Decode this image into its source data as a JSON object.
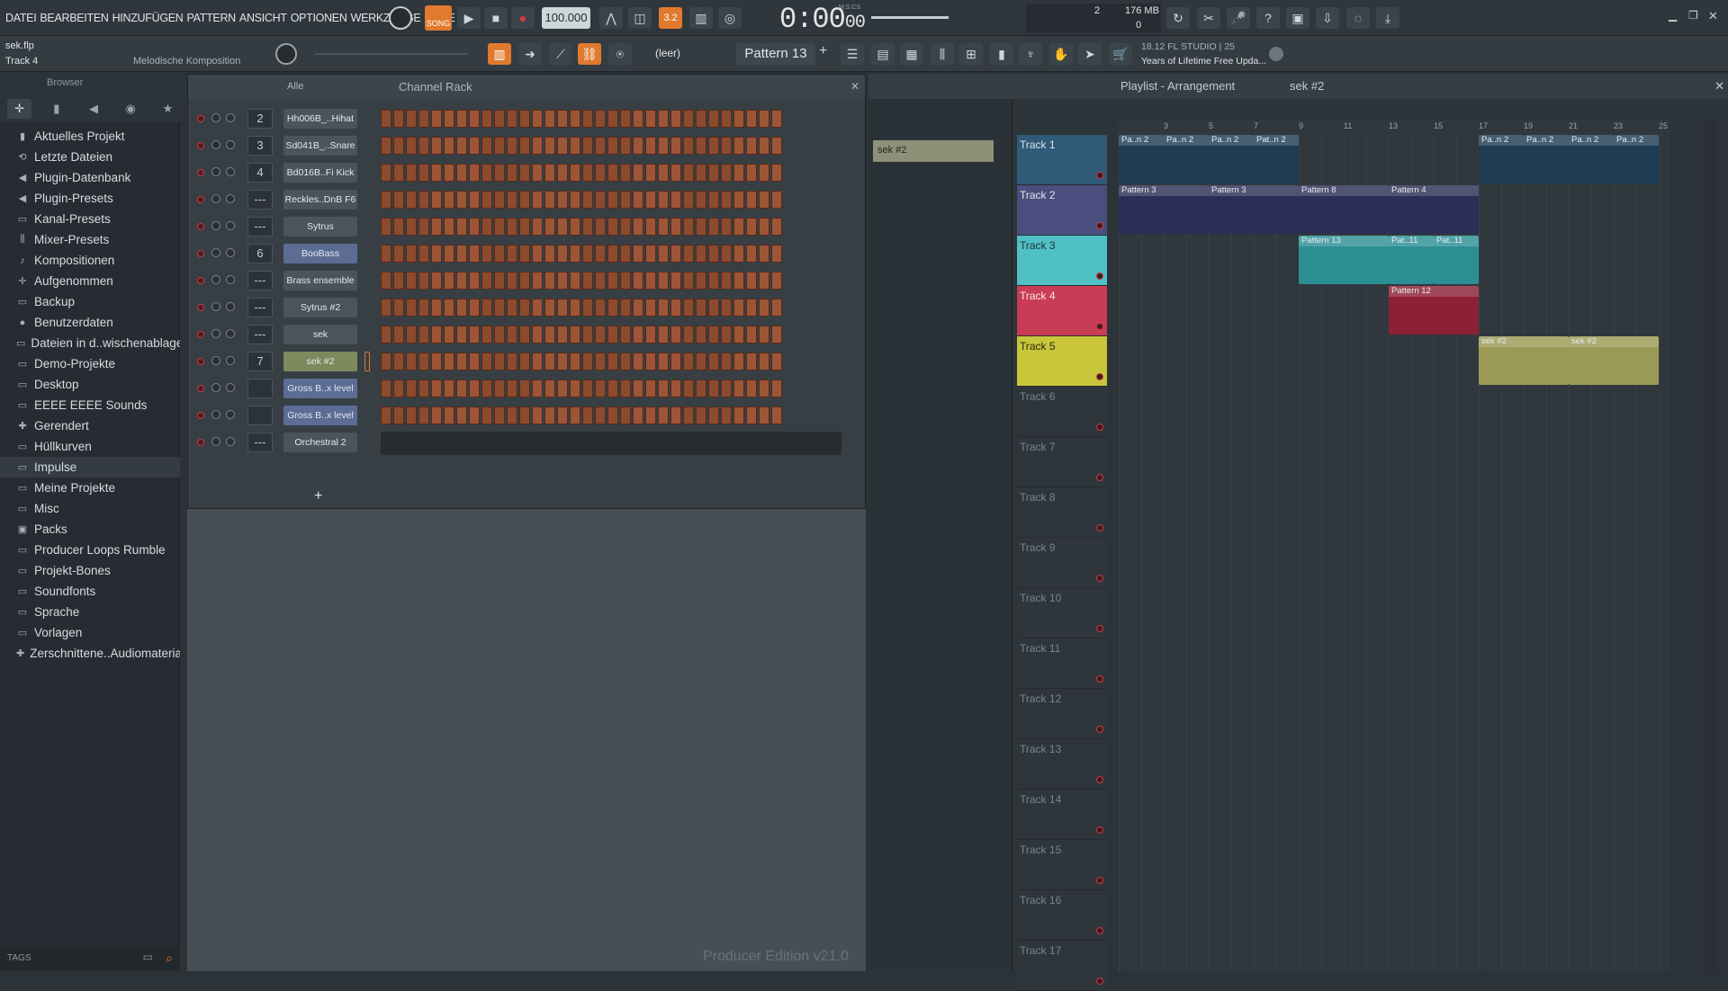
{
  "menu": [
    "DATEI",
    "BEARBEITEN",
    "HINZUFÜGEN",
    "PATTERN",
    "ANSICHT",
    "OPTIONEN",
    "WERKZEUGE",
    "HILFE"
  ],
  "transport": {
    "mode_label": "SONG",
    "tempo": "100.000",
    "time": "0:00",
    "time_sub": "00",
    "time_unit": "M:S:CS",
    "snap": "3.2"
  },
  "memory": {
    "top_num": "2",
    "mb": "176 MB",
    "bottom_num": "0"
  },
  "hint": {
    "file": "sek.flp",
    "track": "Track 4",
    "desc": "Melodische Komposition"
  },
  "pattern": {
    "none_label": "(leer)",
    "name": "Pattern 13"
  },
  "news": {
    "line1": "18.12  FL STUDIO | 25",
    "line2": "Years of Lifetime Free Upda..."
  },
  "browser": {
    "title": "Browser",
    "items": [
      {
        "label": "Aktuelles Projekt",
        "icon": "project-icon"
      },
      {
        "label": "Letzte Dateien",
        "icon": "recent-icon"
      },
      {
        "label": "Plugin-Datenbank",
        "icon": "plugin-icon"
      },
      {
        "label": "Plugin-Presets",
        "icon": "plugin-icon"
      },
      {
        "label": "Kanal-Presets",
        "icon": "folder-icon"
      },
      {
        "label": "Mixer-Presets",
        "icon": "mixer-icon"
      },
      {
        "label": "Kompositionen",
        "icon": "note-icon"
      },
      {
        "label": "Aufgenommen",
        "icon": "rec-icon"
      },
      {
        "label": "Backup",
        "icon": "folder-icon"
      },
      {
        "label": "Benutzerdaten",
        "icon": "user-icon"
      },
      {
        "label": "Dateien in d..wischenablage",
        "icon": "folder-icon"
      },
      {
        "label": "Demo-Projekte",
        "icon": "folder-icon"
      },
      {
        "label": "Desktop",
        "icon": "folder-icon"
      },
      {
        "label": "EEEE EEEE Sounds",
        "icon": "folder-icon"
      },
      {
        "label": "Gerendert",
        "icon": "render-icon"
      },
      {
        "label": "Hüllkurven",
        "icon": "folder-icon"
      },
      {
        "label": "Impulse",
        "icon": "folder-icon"
      },
      {
        "label": "Meine Projekte",
        "icon": "folder-icon"
      },
      {
        "label": "Misc",
        "icon": "folder-icon"
      },
      {
        "label": "Packs",
        "icon": "pack-icon"
      },
      {
        "label": "Producer Loops Rumble",
        "icon": "folder-icon"
      },
      {
        "label": "Projekt-Bones",
        "icon": "folder-icon"
      },
      {
        "label": "Soundfonts",
        "icon": "folder-icon"
      },
      {
        "label": "Sprache",
        "icon": "folder-icon"
      },
      {
        "label": "Vorlagen",
        "icon": "folder-icon"
      },
      {
        "label": "Zerschnittene..Audiomaterial",
        "icon": "cut-icon"
      }
    ],
    "tags": "TAGS"
  },
  "rack": {
    "filter": "Alle",
    "title": "Channel Rack",
    "channels": [
      {
        "num": "2",
        "name": "Hh006B_..Hihat",
        "style": "plain"
      },
      {
        "num": "3",
        "name": "Sd041B_..Snare",
        "style": "plain"
      },
      {
        "num": "4",
        "name": "Bd016B..Fi Kick",
        "style": "plain"
      },
      {
        "num": "---",
        "name": "Reckles..DnB F6",
        "style": "plain"
      },
      {
        "num": "---",
        "name": "Sytrus",
        "style": "plain"
      },
      {
        "num": "6",
        "name": "BooBass",
        "style": "blue"
      },
      {
        "num": "---",
        "name": "Brass ensemble",
        "style": "plain"
      },
      {
        "num": "---",
        "name": "Sytrus #2",
        "style": "plain"
      },
      {
        "num": "---",
        "name": "sek",
        "style": "plain"
      },
      {
        "num": "7",
        "name": "sek #2",
        "style": "green"
      },
      {
        "num": "",
        "name": "Gross B..x level",
        "style": "blue"
      },
      {
        "num": "",
        "name": "Gross B..x level",
        "style": "blue"
      },
      {
        "num": "---",
        "name": "Orchestral 2",
        "style": "plain"
      }
    ],
    "add": "+",
    "edition": "Producer Edition v21.0"
  },
  "playlist": {
    "title": "Playlist - Arrangement",
    "crumb": "sek #2",
    "pattern_selected": "sek #2",
    "ruler": [
      "3",
      "5",
      "7",
      "9",
      "11",
      "13",
      "15",
      "17",
      "19",
      "21",
      "23",
      "25"
    ],
    "tracks": [
      "Track 1",
      "Track 2",
      "Track 3",
      "Track 4",
      "Track 5",
      "Track 6",
      "Track 7",
      "Track 8",
      "Track 9",
      "Track 10",
      "Track 11",
      "Track 12",
      "Track 13",
      "Track 14",
      "Track 15",
      "Track 16",
      "Track 17"
    ],
    "clips": [
      {
        "track": 0,
        "bar": 1,
        "len": 2,
        "label": "Pa..n 2",
        "color": "#1f3c55"
      },
      {
        "track": 0,
        "bar": 3,
        "len": 2,
        "label": "Pa..n 2",
        "color": "#1f3c55"
      },
      {
        "track": 0,
        "bar": 5,
        "len": 2,
        "label": "Pa..n 2",
        "color": "#1f3c55"
      },
      {
        "track": 0,
        "bar": 7,
        "len": 2,
        "label": "Pat..n 2",
        "color": "#1f3c55"
      },
      {
        "track": 0,
        "bar": 17,
        "len": 2,
        "label": "Pa..n 2",
        "color": "#1f3c55"
      },
      {
        "track": 0,
        "bar": 19,
        "len": 2,
        "label": "Pa..n 2",
        "color": "#1f3c55"
      },
      {
        "track": 0,
        "bar": 21,
        "len": 2,
        "label": "Pa..n 2",
        "color": "#1f3c55"
      },
      {
        "track": 0,
        "bar": 23,
        "len": 2,
        "label": "Pa..n 2",
        "color": "#1f3c55"
      },
      {
        "track": 1,
        "bar": 1,
        "len": 4,
        "label": "Pattern 3",
        "color": "#2c2f55"
      },
      {
        "track": 1,
        "bar": 5,
        "len": 4,
        "label": "Pattern 3",
        "color": "#2c2f55"
      },
      {
        "track": 1,
        "bar": 9,
        "len": 4,
        "label": "Pattern 8",
        "color": "#2c2f55"
      },
      {
        "track": 1,
        "bar": 13,
        "len": 4,
        "label": "Pattern 4",
        "color": "#2c2f55"
      },
      {
        "track": 2,
        "bar": 9,
        "len": 4,
        "label": "Pattern 13",
        "color": "#2c8f94"
      },
      {
        "track": 2,
        "bar": 13,
        "len": 2,
        "label": "Pat..11",
        "color": "#2c8f94"
      },
      {
        "track": 2,
        "bar": 15,
        "len": 2,
        "label": "Pat..11",
        "color": "#2c8f94"
      },
      {
        "track": 3,
        "bar": 13,
        "len": 4,
        "label": "Pattern 12",
        "color": "#8c2035"
      },
      {
        "track": 4,
        "bar": 17,
        "len": 4,
        "label": "sek #2",
        "color": "#9a9a55"
      },
      {
        "track": 4,
        "bar": 21,
        "len": 4,
        "label": "sek #2",
        "color": "#9a9a55"
      }
    ]
  }
}
